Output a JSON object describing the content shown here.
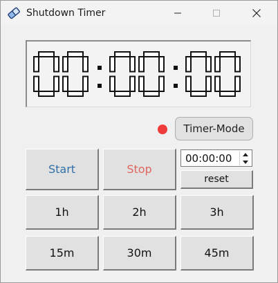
{
  "window": {
    "title": "Shutdown Timer",
    "controls": [
      "minimize",
      "maximize",
      "close"
    ]
  },
  "display": {
    "hours": "00",
    "minutes": "00",
    "seconds": "00",
    "separator": ":"
  },
  "mode": {
    "status_color": "#ef3b3b",
    "button_label": "Timer-Mode"
  },
  "controls": {
    "start_label": "Start",
    "start_color": "#2f6fa8",
    "stop_label": "Stop",
    "stop_color": "#e0655f",
    "time_input_value": "00:00:00",
    "reset_label": "reset"
  },
  "presets": {
    "h1": "1h",
    "h2": "2h",
    "h3": "3h",
    "m15": "15m",
    "m30": "30m",
    "m45": "45m"
  }
}
